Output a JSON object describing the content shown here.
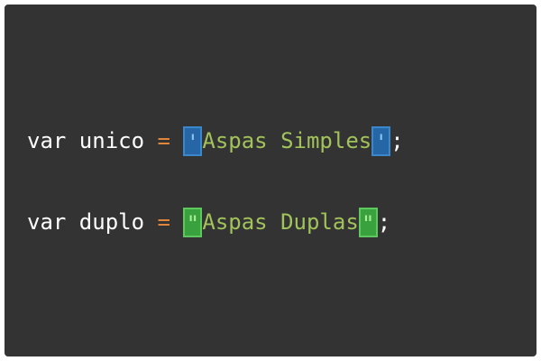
{
  "colors": {
    "background": "#333333",
    "text": "#ffffff",
    "operator": "#e0863a",
    "string": "#a2c25b",
    "single_quote_highlight": "#2766a6",
    "double_quote_highlight": "#39a23f"
  },
  "lines": [
    {
      "keyword": "var",
      "identifier": "unico",
      "operator": "=",
      "open_quote": "'",
      "string": "Aspas Simples",
      "close_quote": "'",
      "terminator": ";"
    },
    {
      "keyword": "var",
      "identifier": "duplo",
      "operator": "=",
      "open_quote": "\"",
      "string": "Aspas Duplas",
      "close_quote": "\"",
      "terminator": ";"
    }
  ]
}
